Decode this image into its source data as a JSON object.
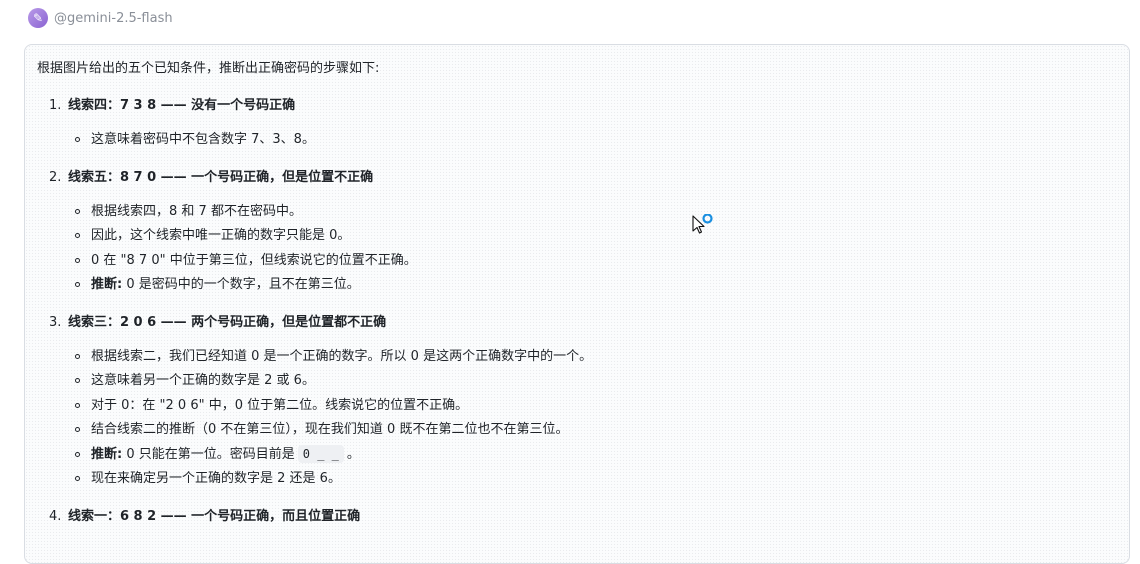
{
  "header": {
    "avatar_icon": "pencil-icon",
    "model_name": "@gemini-2.5-flash"
  },
  "message": {
    "intro": "根据图片给出的五个已知条件，推断出正确密码的步骤如下:",
    "steps": [
      {
        "number": "1.",
        "title": "线索四：7 3 8 —— 没有一个号码正确",
        "items": [
          {
            "text": "这意味着密码中不包含数字 7、3、8。"
          }
        ]
      },
      {
        "number": "2.",
        "title": "线索五：8 7 0 —— 一个号码正确，但是位置不正确",
        "items": [
          {
            "text": "根据线索四，8 和 7 都不在密码中。"
          },
          {
            "text": "因此，这个线索中唯一正确的数字只能是 0。"
          },
          {
            "text": "0 在 \"8 7 0\" 中位于第三位，但线索说它的位置不正确。"
          },
          {
            "bold": "推断:",
            "text": " 0 是密码中的一个数字，且不在第三位。"
          }
        ]
      },
      {
        "number": "3.",
        "title": "线索三：2 0 6 —— 两个号码正确，但是位置都不正确",
        "items": [
          {
            "text": "根据线索二，我们已经知道 0 是一个正确的数字。所以 0 是这两个正确数字中的一个。"
          },
          {
            "text": "这意味着另一个正确的数字是 2 或 6。"
          },
          {
            "text": "对于 0：在 \"2 0 6\" 中，0 位于第二位。线索说它的位置不正确。"
          },
          {
            "text": "结合线索二的推断（0 不在第三位），现在我们知道 0 既不在第二位也不在第三位。"
          },
          {
            "bold": "推断:",
            "text": " 0 只能在第一位。密码目前是",
            "code": "0 _ _",
            "after": "。"
          },
          {
            "text": "现在来确定另一个正确的数字是 2 还是 6。"
          }
        ]
      },
      {
        "number": "4.",
        "title": "线索一：6 8 2 —— 一个号码正确，而且位置正确",
        "items": []
      }
    ]
  },
  "cursor": {
    "icon": "arrow-cursor-with-busy-spinner-icon",
    "spinner_color": "#1a8fe0"
  }
}
